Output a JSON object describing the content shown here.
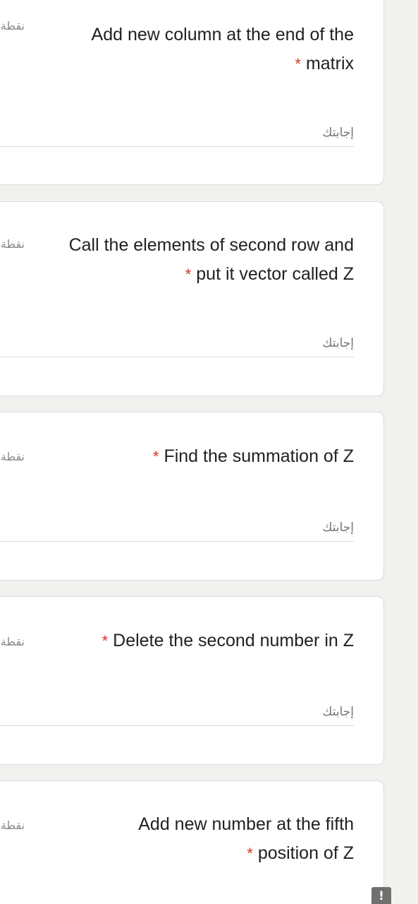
{
  "questions": [
    {
      "points_label": "نقطة",
      "text_line1": "Add new column at the end of the",
      "text_line2": "matrix",
      "required_mark": "*",
      "answer_placeholder": "إجابتك",
      "answer_value": ""
    },
    {
      "points_label": "نقطة",
      "text_line1": "Call the elements of second row and",
      "text_line2": "put it vector called Z",
      "required_mark": "*",
      "answer_placeholder": "إجابتك",
      "answer_value": ""
    },
    {
      "points_label": "نقطة",
      "text_line1": "Find the summation of Z",
      "text_line2": "",
      "required_mark": "*",
      "answer_placeholder": "إجابتك",
      "answer_value": ""
    },
    {
      "points_label": "نقطة",
      "text_line1": "Delete the second number in Z",
      "text_line2": "",
      "required_mark": "*",
      "answer_placeholder": "إجابتك",
      "answer_value": ""
    },
    {
      "points_label": "نقطة",
      "text_line1": "Add new number at the fifth",
      "text_line2": "position of Z",
      "required_mark": "*",
      "answer_placeholder": "",
      "answer_value": ""
    }
  ],
  "report_button": {
    "label": "!"
  },
  "colors": {
    "background": "#f1f1ee",
    "card": "#ffffff",
    "required": "#d93025",
    "text": "#202124",
    "muted": "#757575"
  }
}
